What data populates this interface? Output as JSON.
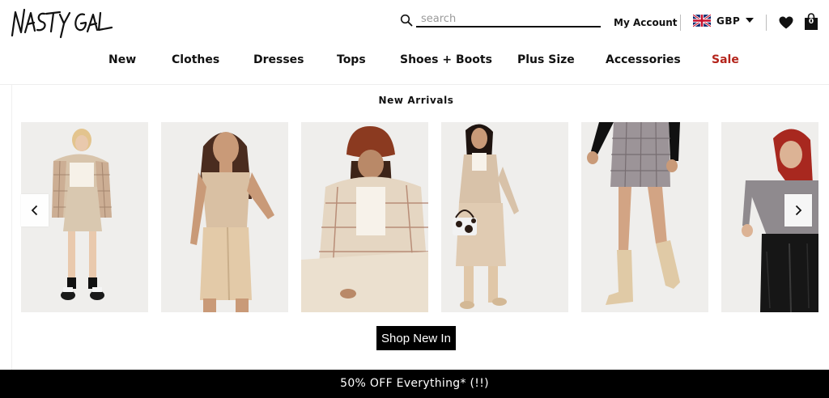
{
  "brand": {
    "logo_text": "NASTY GAL"
  },
  "search": {
    "placeholder": "search",
    "value": ""
  },
  "account": {
    "label": "My Account"
  },
  "currency": {
    "code": "GBP",
    "flag": "uk-flag-icon"
  },
  "wishlist": {
    "icon": "heart-icon"
  },
  "bag": {
    "icon": "shopping-bag-icon",
    "count": "0"
  },
  "nav": {
    "items": [
      {
        "label": "New"
      },
      {
        "label": "Clothes"
      },
      {
        "label": "Dresses"
      },
      {
        "label": "Tops"
      },
      {
        "label": "Shoes + Boots"
      },
      {
        "label": "Plus Size"
      },
      {
        "label": "Accessories"
      },
      {
        "label": "Sale",
        "color": "#b4241b"
      }
    ]
  },
  "carousel": {
    "title": "New Arrivals",
    "prev_icon": "chevron-left-icon",
    "next_icon": "chevron-right-icon",
    "products": [
      {
        "image": "product-photo-plaid-shacket-pleated-skirt"
      },
      {
        "image": "product-photo-beige-tank-leather-skirt"
      },
      {
        "image": "product-photo-bucket-hat-check-shirt"
      },
      {
        "image": "product-photo-knit-dress-cow-bag"
      },
      {
        "image": "product-photo-check-mini-skirt-boots"
      },
      {
        "image": "product-photo-grey-top-vinyl-trousers"
      }
    ],
    "cta_label": "Shop New In"
  },
  "promo": {
    "text": "50% OFF Everything* (!!)"
  },
  "colors": {
    "sale": "#b4241b",
    "banner_bg": "#000000",
    "photo_bg": "#efeeec"
  }
}
